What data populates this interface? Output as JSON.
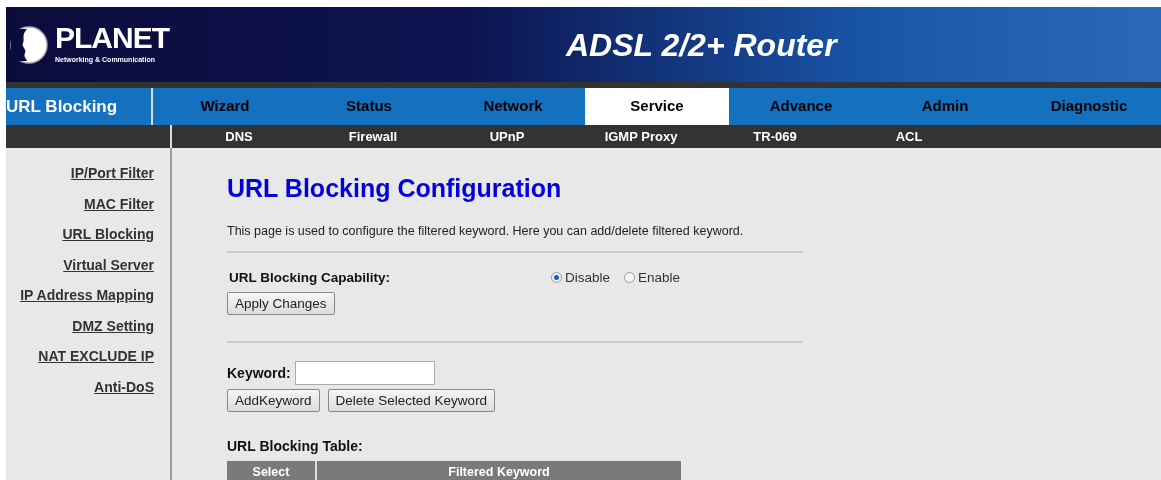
{
  "header": {
    "logo": "PLANET",
    "logo_tagline": "Networking & Communication",
    "product": "ADSL 2/2+ Router"
  },
  "section_title": "URL Blocking",
  "tabs": [
    {
      "label": "Wizard",
      "selected": false
    },
    {
      "label": "Status",
      "selected": false
    },
    {
      "label": "Network",
      "selected": false
    },
    {
      "label": "Service",
      "selected": true
    },
    {
      "label": "Advance",
      "selected": false
    },
    {
      "label": "Admin",
      "selected": false
    },
    {
      "label": "Diagnostic",
      "selected": false
    }
  ],
  "subtabs": [
    "DNS",
    "Firewall",
    "UPnP",
    "IGMP Proxy",
    "TR-069",
    "ACL"
  ],
  "sidebar": {
    "items": [
      "IP/Port Filter",
      "MAC Filter",
      "URL Blocking",
      "Virtual Server",
      "IP Address Mapping",
      "DMZ Setting",
      "NAT EXCLUDE IP",
      "Anti-DoS"
    ]
  },
  "page_title": "URL Blocking Configuration",
  "description": "This page is used to configure the filtered keyword. Here you can add/delete filtered keyword.",
  "capability": {
    "label": "URL Blocking Capability:",
    "options": [
      {
        "label": "Disable",
        "selected": true
      },
      {
        "label": "Enable",
        "selected": false
      }
    ]
  },
  "apply_button": "Apply Changes",
  "keyword": {
    "label": "Keyword:"
  },
  "buttons": [
    "AddKeyword",
    "Delete Selected Keyword"
  ],
  "table": {
    "title": "URL Blocking Table:",
    "columns": [
      "Select",
      "Filtered Keyword"
    ]
  }
}
